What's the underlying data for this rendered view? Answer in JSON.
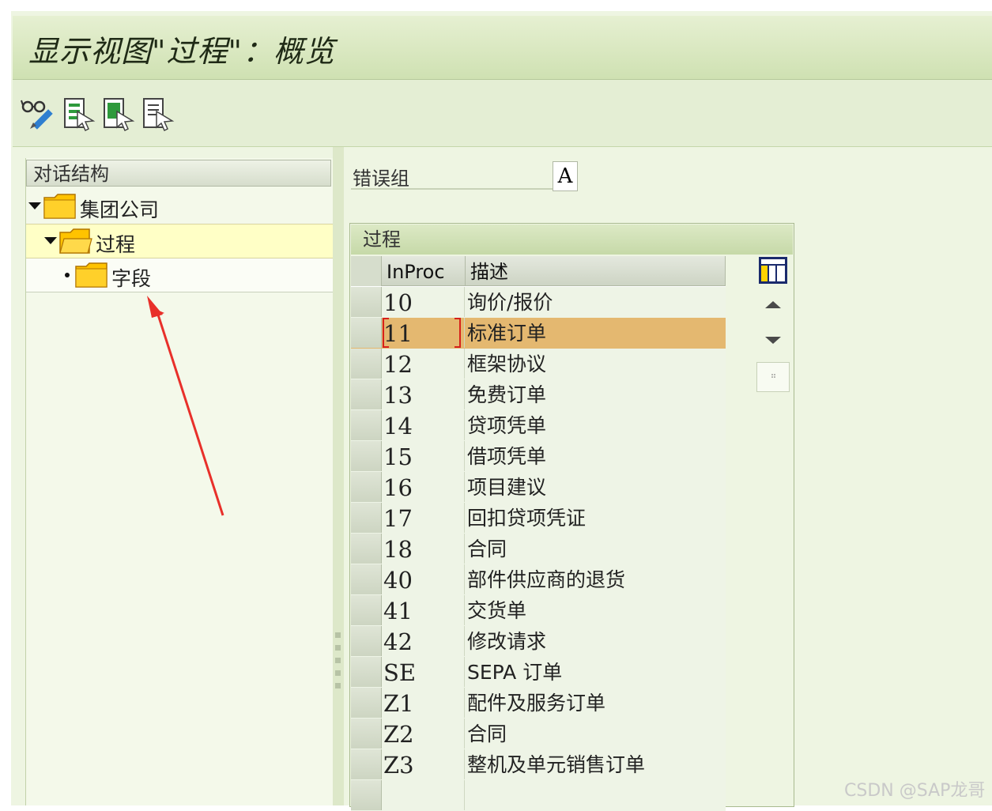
{
  "window": {
    "title": "显示视图\"过程\"：概览"
  },
  "toolbar": {
    "buttons": [
      {
        "icon": "glasses-pencil-icon"
      },
      {
        "icon": "select-all-icon"
      },
      {
        "icon": "select-block-icon"
      },
      {
        "icon": "deselect-all-icon"
      }
    ]
  },
  "dialog_structure": {
    "header": "对话结构",
    "items": [
      {
        "label": "集团公司",
        "level": 0,
        "expanded": true
      },
      {
        "label": "过程",
        "level": 1,
        "expanded": true,
        "selected": true
      },
      {
        "label": "字段",
        "level": 2
      }
    ]
  },
  "error_group": {
    "label": "错误组",
    "value": "A"
  },
  "process_table": {
    "title": "过程",
    "columns": [
      "InProc",
      "描述"
    ],
    "rows": [
      {
        "code": "10",
        "desc": "询价/报价"
      },
      {
        "code": "11",
        "desc": "标准订单",
        "selected": true
      },
      {
        "code": "12",
        "desc": "框架协议"
      },
      {
        "code": "13",
        "desc": "免费订单"
      },
      {
        "code": "14",
        "desc": "贷项凭单"
      },
      {
        "code": "15",
        "desc": "借项凭单"
      },
      {
        "code": "16",
        "desc": "项目建议"
      },
      {
        "code": "17",
        "desc": "回扣贷项凭证"
      },
      {
        "code": "18",
        "desc": "合同"
      },
      {
        "code": "40",
        "desc": "部件供应商的退货"
      },
      {
        "code": "41",
        "desc": "交货单"
      },
      {
        "code": "42",
        "desc": "修改请求"
      },
      {
        "code": "SE",
        "desc": "SEPA 订单"
      },
      {
        "code": "Z1",
        "desc": "配件及服务订单"
      },
      {
        "code": "Z2",
        "desc": "合同"
      },
      {
        "code": "Z3",
        "desc": "整机及单元销售订单"
      }
    ]
  },
  "colors": {
    "selected_row": "#e4b870",
    "tree_selected": "#ffffc6",
    "annotation_arrow": "#e8302a"
  },
  "watermark": "CSDN @SAP龙哥"
}
